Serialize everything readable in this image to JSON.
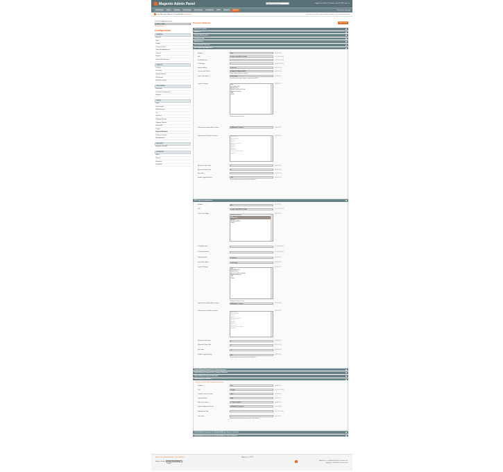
{
  "header": {
    "logo": "Magento Admin Panel",
    "search_placeholder": "Global Record Search",
    "links": "Logged in as default | Thursday, June 30, 2016 | Log Out"
  },
  "nav": {
    "items": [
      "Dashboard",
      "Sales",
      "Catalog",
      "Customers",
      "Promotions",
      "Newsletter",
      "CMS",
      "Reports",
      "System"
    ],
    "active": 8,
    "help": "Get help for this page"
  },
  "notice": {
    "text": "Latest Message: Magento 2.0 Now Available",
    "link": "Read details",
    "right": "You have 4 critical, 8 major unread message(s). Go to messages inbox"
  },
  "sidebar": {
    "scope_label": "Current Configuration Scope:",
    "scope_value": "Default Config",
    "manage": "Manage Stores",
    "config_title": "Configuration",
    "groups": [
      {
        "title": "General",
        "items": [
          "General",
          "Web",
          "Design",
          "Currency Setup",
          "Store Email Addresses",
          "Contacts",
          "Reports",
          "Content Management"
        ]
      },
      {
        "title": "Catalog",
        "items": [
          "Catalog",
          "Inventory",
          "Google Sitemap",
          "RSS Feeds",
          "Email to a Friend"
        ]
      },
      {
        "title": "Customers",
        "items": [
          "Newsletter",
          "Customer Configuration",
          "Wishlist"
        ]
      },
      {
        "title": "Sales",
        "items": [
          "Sales",
          "Sales Emails",
          "PDF Print-outs",
          "Tax",
          "Checkout",
          "Shipping Settings",
          "Shipping Methods",
          "Google API",
          "Paypal",
          "Payment Methods",
          "Payment Services",
          "Moneybookers"
        ]
      },
      {
        "title": "Services",
        "items": [
          "Magento Core API"
        ]
      },
      {
        "title": "Advanced",
        "items": [
          "Admin",
          "System",
          "Advanced",
          "Developer"
        ]
      }
    ],
    "current": "Payment Methods"
  },
  "main": {
    "title": "Payment Methods",
    "save": "Save Config",
    "top_sections": [
      "Merchant Location",
      "Saved CC",
      "Check / Money order",
      "Purchase Order",
      "Authorize.net",
      "Zero Subtotal Checkout"
    ],
    "s1": {
      "title": "EPS Paybox by Magentizen"
    },
    "s2": {
      "title": "EPS Paybox by Magentizen"
    },
    "mid_sections": [
      "PayPal Website Payments Pro - Direct Payments",
      "PayPal Website Payments Pro - Express Checkout",
      "PayPal Website Payments Standard"
    ],
    "s3": {
      "title": "PayPal Express Checkout",
      "sublink": "Express Checkout Merchant Account Settings"
    },
    "bottom_sections": [
      "PayPal Website Payments Pro (PayflowEdition) - Express Checkout",
      "PayPal Website Payments Pro (PayflowEdition) - Direct Payments"
    ],
    "global": "[WEBSITE]",
    "store": "[STORE VIEW]",
    "rows": [
      {
        "l": "Enabled",
        "v": "Yes",
        "s": "[WEBSITE]"
      },
      {
        "l": "Title",
        "v": "Credit Card (EPS PaYbox)",
        "s": "[STORE VIEW]"
      },
      {
        "l": "PaYboxAccount",
        "v": "",
        "s": "[STORE VIEW]"
      },
      {
        "l": "PaYboxkey",
        "v": "",
        "s": "[STORE VIEW]"
      },
      {
        "l": "Payment Action",
        "v": "Purchase",
        "s": "[WEBSITE]"
      },
      {
        "l": "Create Order Status",
        "v": "Pending Payment (EPS)",
        "s": "[WEBSITE]",
        "n": "Select status payment is created"
      },
      {
        "l": "Save Order Status",
        "v": "Processing",
        "s": "[WEBSITE]",
        "n": "Status after receiving a positive response from EPS"
      },
      {
        "l": "Logos to Display",
        "s": "[WEBSITE]"
      },
      {
        "l": "Payment from applicable countries",
        "v": "All Allowed Countries",
        "s": "[WEBSITE]"
      },
      {
        "l": "Payment from Specific countries",
        "s": "[WEBSITE]"
      },
      {
        "l": "Minimum Order Total",
        "v": "0",
        "s": "[WEBSITE]"
      },
      {
        "l": "Maximum Order Total",
        "v": "0",
        "s": "[WEBSITE]"
      },
      {
        "l": "Sort order",
        "v": "",
        "s": "[WEBSITE]"
      },
      {
        "l": "Enable Logging/Debug",
        "v": "Yes",
        "s": "[WEBSITE]",
        "n": "Log all requests and responses to the database"
      }
    ],
    "rows2": [
      {
        "l": "Enabled",
        "v": "No",
        "s": "[WEBSITE]"
      },
      {
        "l": "Title",
        "v": "Credit Card (EPS PaYbox)",
        "s": "[STORE VIEW]"
      },
      {
        "l": "Credit Card Types",
        "s": "[WEBSITE]"
      },
      {
        "l": "PaYboxAccount",
        "v": "",
        "s": "[STORE VIEW]"
      },
      {
        "l": "PaYboxPassword",
        "v": "",
        "s": "[STORE VIEW]"
      },
      {
        "l": "Payment Action",
        "v": "Purchase",
        "s": "[WEBSITE]"
      },
      {
        "l": "Save Order Status",
        "v": "Processing",
        "s": "[WEBSITE]"
      },
      {
        "l": "Logos to Display",
        "s": "[WEBSITE]"
      },
      {
        "l": "Payment from applicable countries",
        "v": "All Allowed Countries",
        "s": "[WEBSITE]"
      },
      {
        "l": "Payment from Specific countries",
        "s": "[WEBSITE]"
      },
      {
        "l": "Minimum Order Total",
        "v": "0",
        "s": "[WEBSITE]"
      },
      {
        "l": "Maximum Order Total",
        "v": "0",
        "s": "[WEBSITE]"
      },
      {
        "l": "Sort order",
        "v": "1",
        "s": "[WEBSITE]"
      },
      {
        "l": "Enable Logging/Debug",
        "v": "No",
        "s": "[WEBSITE]",
        "n": "Log all requests and responses to the database"
      }
    ],
    "rows3": [
      {
        "l": "Enabled",
        "v": "Yes",
        "s": "[WEBSITE]"
      },
      {
        "l": "Title",
        "v": "Paypal",
        "s": "[STORE VIEW]"
      },
      {
        "l": "Transfer Cart Line Items",
        "v": "Yes",
        "s": "[WEBSITE]"
      },
      {
        "l": "Payment Action",
        "v": "Sale",
        "s": "[WEBSITE]"
      },
      {
        "l": "New Order Status",
        "v": "-- Please Select --",
        "s": "[WEBSITE]"
      },
      {
        "l": "Payment Applicable From",
        "v": "All Allowed Countries",
        "s": "[WEBSITE]"
      },
      {
        "l": "Subscription Title",
        "v": "",
        "s": "[STORE VIEW]"
      },
      {
        "l": "Sort Order",
        "v": "",
        "s": "[WEBSITE]",
        "n": "Displayed at Paypal.de during checkout at the bottom"
      }
    ],
    "logos": [
      "Visa",
      "Verified by Visa",
      "MasterCard",
      "MasterCard SecureCode",
      "American Express",
      "JCB",
      "Diners"
    ],
    "logos_note": "Displayed during checkout",
    "countries": [
      "Afghanistan",
      "Åland Islands",
      "Albania",
      "Algeria",
      "American Samoa",
      "Andorra",
      "Angola",
      "Anguilla",
      "Antarctica",
      "Antigua and Barbuda",
      "Argentina"
    ],
    "cc_types": [
      "American Express",
      "Visa",
      "MasterCard",
      "Maestro",
      "Mastercard/Visa",
      "Diners"
    ],
    "cc_selected": [
      1,
      2
    ]
  },
  "footer": {
    "help": "Help Us Keep Magento Healthy - Report All Bugs",
    "locale_label": "Interface Locale:",
    "locale": "English (United States) / English",
    "center": "Magento ver. 1.9.2.1",
    "right1": "Magento™ is a trademark of Each Commerce Inc.",
    "right2": "Copyright © 2016 Each Commerce Inc."
  }
}
